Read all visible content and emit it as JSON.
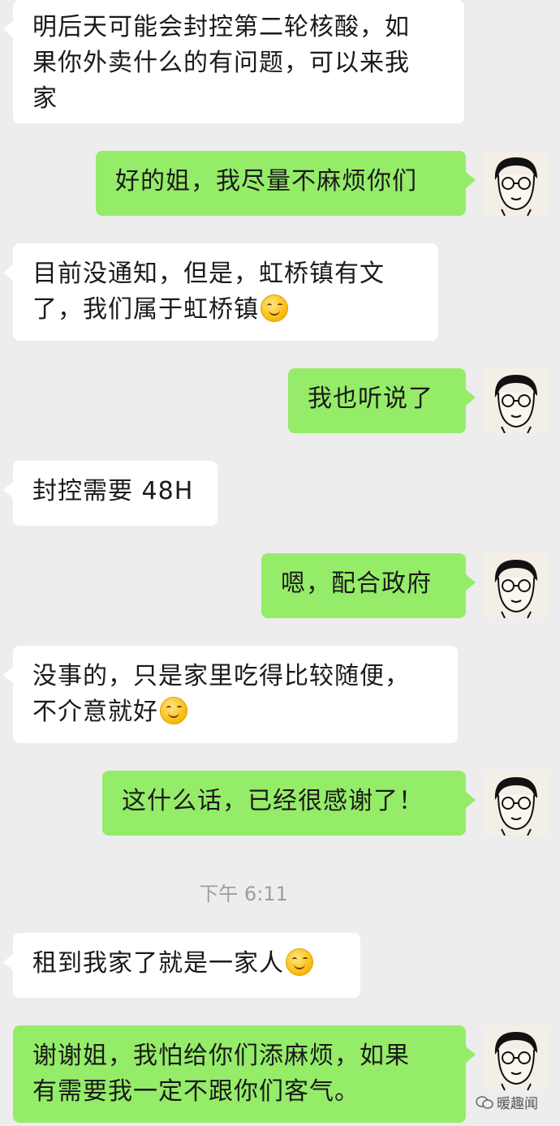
{
  "messages": [
    {
      "side": "left",
      "text": "明后天可能会封控第二轮核酸，如\n果你外卖什么的有问题，可以来我\n家",
      "emoji": false
    },
    {
      "side": "right",
      "text": "好的姐，我尽量不麻烦你们",
      "emoji": false
    },
    {
      "side": "left",
      "text": "目前没通知，但是，虹桥镇有文\n了，我们属于虹桥镇",
      "emoji": true
    },
    {
      "side": "right",
      "text": "我也听说了",
      "emoji": false
    },
    {
      "side": "left",
      "text": "封控需要 48H",
      "emoji": false
    },
    {
      "side": "right",
      "text": "嗯，配合政府",
      "emoji": false
    },
    {
      "side": "left",
      "text": "没事的，只是家里吃得比较随便，\n不介意就好",
      "emoji": true
    },
    {
      "side": "right",
      "text": "这什么话，已经很感谢了！",
      "emoji": false
    },
    {
      "side": "left",
      "text": "租到我家了就是一家人",
      "emoji": true
    },
    {
      "side": "right",
      "text": "谢谢姐，我怕给你们添麻烦，如果\n有需要我一定不跟你们客气。",
      "emoji": false
    }
  ],
  "timestamp": "下午 6:11",
  "watermark": "暖趣闻",
  "colors": {
    "background": "#ededed",
    "sent_bubble": "#95ec69",
    "received_bubble": "#ffffff"
  },
  "avatar_icon": "cartoon-glasses-man-avatar",
  "emoji_icon": "smiling-face-emoji"
}
